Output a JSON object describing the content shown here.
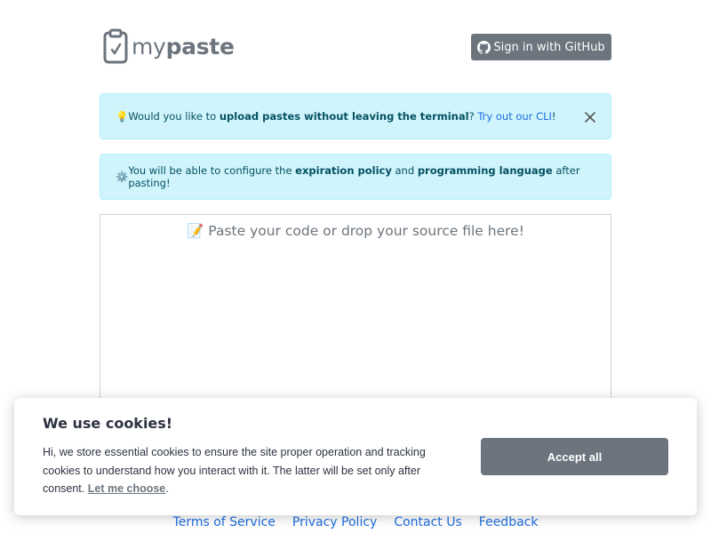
{
  "brand": {
    "name_light": "my",
    "name_bold": "paste"
  },
  "header": {
    "github_button_label": "Sign in with GitHub"
  },
  "alerts": {
    "cli": {
      "prefix": " Would you like to ",
      "bold": "upload pastes without leaving the terminal",
      "middle": "? ",
      "link": "Try out our CLI",
      "suffix": "!"
    },
    "config": {
      "prefix": " You will be able to configure the ",
      "bold1": "expiration policy",
      "middle": " and ",
      "bold2": "programming language",
      "suffix": " after pasting!"
    }
  },
  "editor": {
    "placeholder": "📝 Paste your code or drop your source file here!"
  },
  "cookie": {
    "title": "We use cookies!",
    "description": "Hi, we store essential cookies to ensure the site proper operation and tracking cookies to understand how you interact with it. The latter will be set only after consent. ",
    "choose_link": "Let me choose",
    "description_end": ".",
    "accept_label": "Accept all"
  },
  "footer": {
    "links": [
      "Terms of Service",
      "Privacy Policy",
      "Contact Us",
      "Feedback"
    ]
  },
  "colors": {
    "secondary": "#6c757d",
    "info_bg": "#cff4fc",
    "info_text": "#055160",
    "link": "#1f6fe0"
  }
}
